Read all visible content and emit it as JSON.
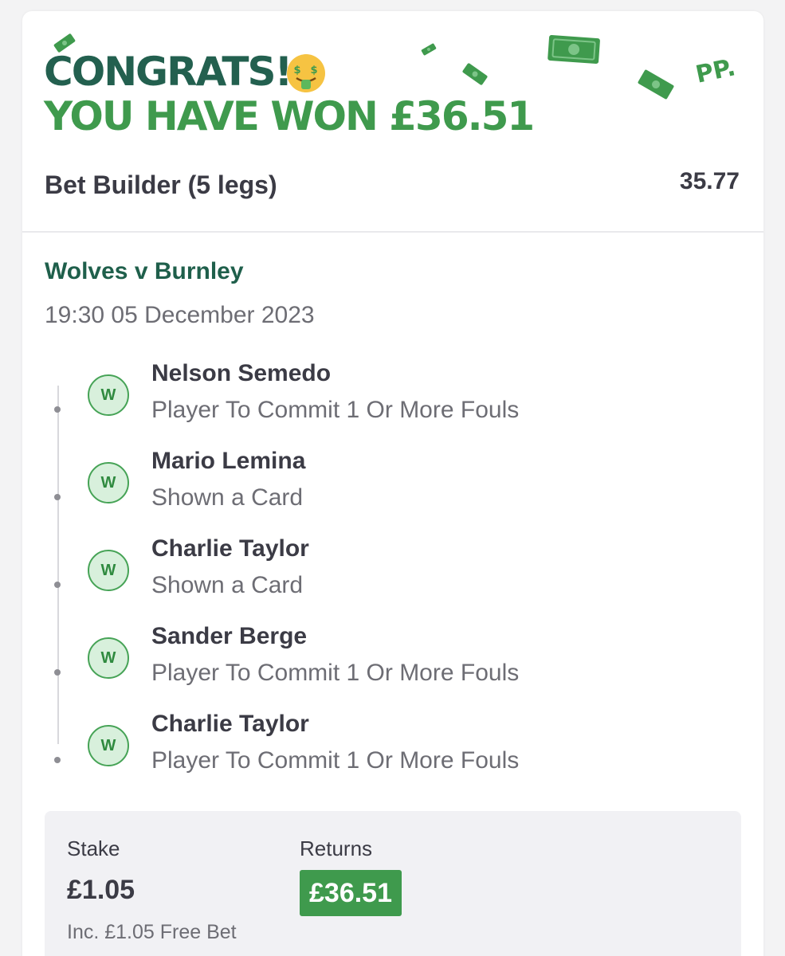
{
  "header": {
    "congrats": "CONGRATS!",
    "won": "YOU HAVE WON £36.51",
    "pp_logo": "PP.",
    "emoji_icon": "money-mouth-face-icon"
  },
  "bet": {
    "title": "Bet Builder (5 legs)",
    "odds": "35.77"
  },
  "event": {
    "name": "Wolves v Burnley",
    "time": "19:30 05 December 2023"
  },
  "legs": [
    {
      "result": "W",
      "player": "Nelson Semedo",
      "market": "Player To Commit 1 Or More Fouls"
    },
    {
      "result": "W",
      "player": "Mario Lemina",
      "market": "Shown a Card"
    },
    {
      "result": "W",
      "player": "Charlie Taylor",
      "market": "Shown a Card"
    },
    {
      "result": "W",
      "player": "Sander Berge",
      "market": "Player To Commit 1 Or More Fouls"
    },
    {
      "result": "W",
      "player": "Charlie Taylor",
      "market": "Player To Commit 1 Or More Fouls"
    }
  ],
  "summary": {
    "stake_label": "Stake",
    "stake_value": "£1.05",
    "free_bet": "Inc. £1.05 Free Bet",
    "returns_label": "Returns",
    "returns_value": "£36.51"
  },
  "colors": {
    "dark_green": "#23604f",
    "brand_green": "#3f9a4d",
    "win_badge_bg": "#d8f0dc"
  }
}
